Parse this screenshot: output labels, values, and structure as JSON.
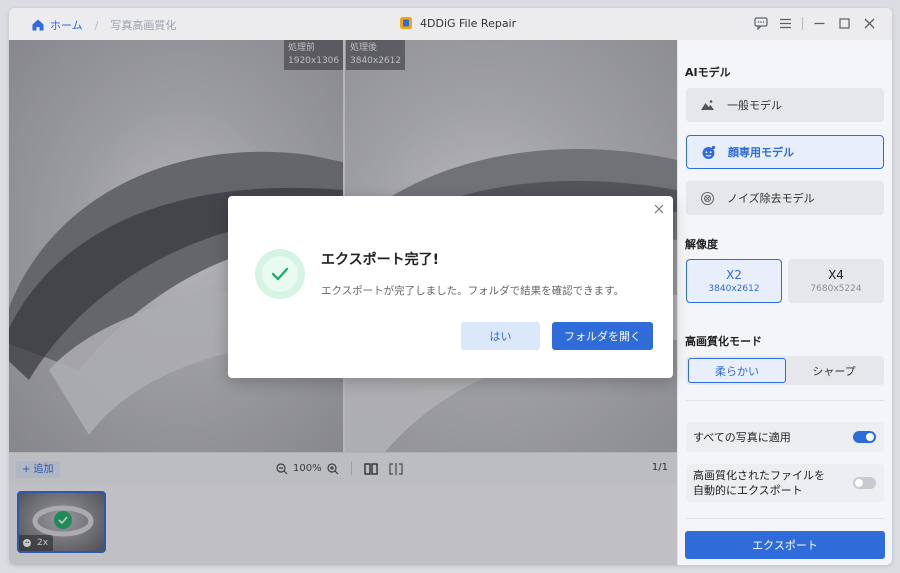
{
  "titlebar": {
    "breadcrumb_home": "ホーム",
    "breadcrumb_sep": "/",
    "breadcrumb_current": "写真高画質化",
    "app_title": "4DDiG File Repair"
  },
  "preview": {
    "before_label": "処理前",
    "before_size": "1920x1306",
    "after_label": "処理後",
    "after_size": "3840x2612"
  },
  "toolbar": {
    "add_label": "+ 追加",
    "zoom_value": "100%",
    "page_count": "1/1"
  },
  "thumbnail": {
    "scale_label": "2x"
  },
  "panel": {
    "ai_model_title": "AIモデル",
    "models": [
      {
        "label": "一般モデル",
        "icon": "mountain-icon",
        "active": false
      },
      {
        "label": "顔専用モデル",
        "icon": "face-icon",
        "active": true
      },
      {
        "label": "ノイズ除去モデル",
        "icon": "noise-icon",
        "active": false
      }
    ],
    "resolution_title": "解像度",
    "resolutions": [
      {
        "label": "X2",
        "size": "3840x2612",
        "active": true
      },
      {
        "label": "X4",
        "size": "7680x5224",
        "active": false
      }
    ],
    "mode_title": "高画質化モード",
    "modes": [
      {
        "label": "柔らかい",
        "active": true
      },
      {
        "label": "シャープ",
        "active": false
      }
    ],
    "apply_all_label": "すべての写真に適用",
    "apply_all_on": true,
    "auto_export_label_1": "高画質化されたファイルを",
    "auto_export_label_2": "自動的にエクスポート",
    "auto_export_on": false,
    "export_label": "エクスポート"
  },
  "dialog": {
    "title": "エクスポート完了!",
    "message": "エクスポートが完了しました。フォルダで結果を確認できます。",
    "yes_label": "はい",
    "open_folder_label": "フォルダを開く"
  },
  "colors": {
    "accent": "#2f6bd9",
    "success": "#1fae6a"
  }
}
